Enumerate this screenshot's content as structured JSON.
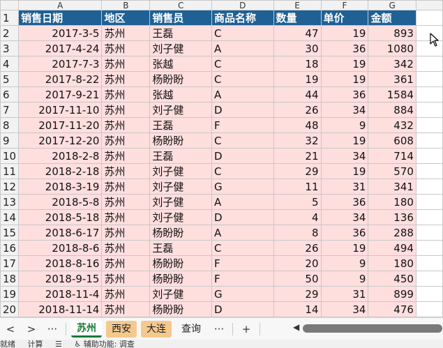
{
  "columns": [
    "A",
    "B",
    "C",
    "D",
    "E",
    "F",
    "G"
  ],
  "header_row": {
    "row": "1",
    "cells": [
      "销售日期",
      "地区",
      "销售员",
      "商品名称",
      "数量",
      "单价",
      "金额"
    ]
  },
  "rows": [
    {
      "row": "2",
      "date": "2017-3-5",
      "region": "苏州",
      "seller": "王磊",
      "product": "C",
      "qty": "47",
      "price": "19",
      "amount": "893"
    },
    {
      "row": "3",
      "date": "2017-4-24",
      "region": "苏州",
      "seller": "刘子健",
      "product": "A",
      "qty": "30",
      "price": "36",
      "amount": "1080"
    },
    {
      "row": "4",
      "date": "2017-7-3",
      "region": "苏州",
      "seller": "张越",
      "product": "C",
      "qty": "18",
      "price": "19",
      "amount": "342"
    },
    {
      "row": "5",
      "date": "2017-8-22",
      "region": "苏州",
      "seller": "杨盼盼",
      "product": "C",
      "qty": "19",
      "price": "19",
      "amount": "361"
    },
    {
      "row": "6",
      "date": "2017-9-21",
      "region": "苏州",
      "seller": "张越",
      "product": "A",
      "qty": "44",
      "price": "36",
      "amount": "1584"
    },
    {
      "row": "7",
      "date": "2017-11-10",
      "region": "苏州",
      "seller": "刘子健",
      "product": "D",
      "qty": "26",
      "price": "34",
      "amount": "884"
    },
    {
      "row": "8",
      "date": "2017-11-20",
      "region": "苏州",
      "seller": "王磊",
      "product": "F",
      "qty": "48",
      "price": "9",
      "amount": "432"
    },
    {
      "row": "9",
      "date": "2017-12-20",
      "region": "苏州",
      "seller": "杨盼盼",
      "product": "C",
      "qty": "32",
      "price": "19",
      "amount": "608"
    },
    {
      "row": "10",
      "date": "2018-2-8",
      "region": "苏州",
      "seller": "王磊",
      "product": "D",
      "qty": "21",
      "price": "34",
      "amount": "714"
    },
    {
      "row": "11",
      "date": "2018-2-18",
      "region": "苏州",
      "seller": "刘子健",
      "product": "C",
      "qty": "29",
      "price": "19",
      "amount": "570"
    },
    {
      "row": "12",
      "date": "2018-3-19",
      "region": "苏州",
      "seller": "刘子健",
      "product": "G",
      "qty": "11",
      "price": "31",
      "amount": "341"
    },
    {
      "row": "13",
      "date": "2018-5-8",
      "region": "苏州",
      "seller": "刘子健",
      "product": "A",
      "qty": "5",
      "price": "36",
      "amount": "180"
    },
    {
      "row": "14",
      "date": "2018-5-18",
      "region": "苏州",
      "seller": "刘子健",
      "product": "D",
      "qty": "4",
      "price": "34",
      "amount": "136"
    },
    {
      "row": "15",
      "date": "2018-6-17",
      "region": "苏州",
      "seller": "杨盼盼",
      "product": "A",
      "qty": "8",
      "price": "36",
      "amount": "288"
    },
    {
      "row": "16",
      "date": "2018-8-6",
      "region": "苏州",
      "seller": "王磊",
      "product": "C",
      "qty": "26",
      "price": "19",
      "amount": "494"
    },
    {
      "row": "17",
      "date": "2018-8-16",
      "region": "苏州",
      "seller": "杨盼盼",
      "product": "F",
      "qty": "20",
      "price": "9",
      "amount": "180"
    },
    {
      "row": "18",
      "date": "2018-9-15",
      "region": "苏州",
      "seller": "杨盼盼",
      "product": "F",
      "qty": "50",
      "price": "9",
      "amount": "450"
    },
    {
      "row": "19",
      "date": "2018-11-4",
      "region": "苏州",
      "seller": "刘子健",
      "product": "G",
      "qty": "29",
      "price": "31",
      "amount": "899"
    },
    {
      "row": "20",
      "date": "2018-11-14",
      "region": "苏州",
      "seller": "杨盼盼",
      "product": "D",
      "qty": "14",
      "price": "34",
      "amount": "476"
    }
  ],
  "tabs": {
    "prev": "<",
    "next": ">",
    "more_left": "···",
    "sheets": [
      {
        "label": "苏州",
        "state": "active"
      },
      {
        "label": "西安",
        "state": "colored"
      },
      {
        "label": "大连",
        "state": "colored"
      },
      {
        "label": "查询",
        "state": "plain"
      }
    ],
    "more_right": "···",
    "add": "+"
  },
  "statusbar": {
    "items": [
      "就绪",
      "计算",
      "☰",
      "♿ 辅助功能: 调查"
    ]
  },
  "colors": {
    "header_bg": "#1f6195",
    "row_bg": "#ffdede",
    "active_tab": "#1a7a33",
    "colored_tab": "#f4c98e"
  }
}
